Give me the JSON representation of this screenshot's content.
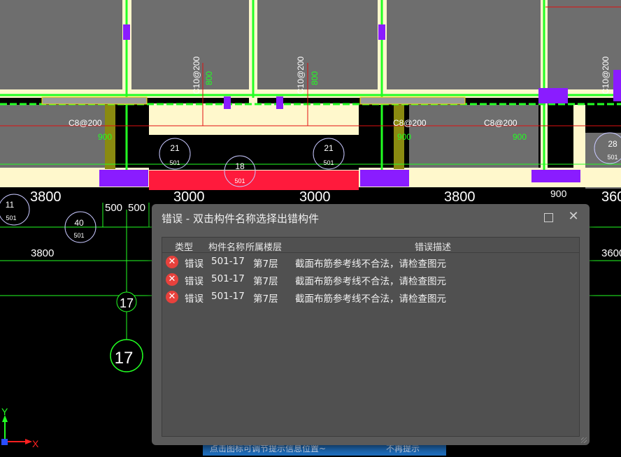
{
  "dialog": {
    "title": "错误 - 双击构件名称选择出错构件",
    "columns": [
      "类型",
      "构件名称",
      "所属楼层",
      "错误描述"
    ],
    "rows": [
      {
        "type": "错误",
        "name": "501-17",
        "floor": "第7层",
        "desc": "截面布筋参考线不合法，请检查图元"
      },
      {
        "type": "错误",
        "name": "501-17",
        "floor": "第7层",
        "desc": "截面布筋参考线不合法，请检查图元"
      },
      {
        "type": "错误",
        "name": "501-17",
        "floor": "第7层",
        "desc": "截面布筋参考线不合法，请检查图元"
      }
    ]
  },
  "toast": {
    "text1": "点击图标可调节提示信息位置~",
    "text2": "不再提示"
  },
  "drawing": {
    "dims_top": [
      "3800",
      "3000",
      "3000",
      "3800",
      "360"
    ],
    "dims_mid": [
      "500",
      "500",
      "900"
    ],
    "dims_low": [
      "3800",
      "3600"
    ],
    "beam_labels": [
      "C10@200",
      "C10@200",
      "C10@200",
      "C8@200",
      "C8@200",
      "C8@200"
    ],
    "green_labels": [
      "800",
      "800",
      "900",
      "900",
      "900"
    ],
    "circle_tags": [
      {
        "num": "11",
        "sub": "501"
      },
      {
        "num": "40",
        "sub": "501"
      },
      {
        "num": "21",
        "sub": "501"
      },
      {
        "num": "18",
        "sub": "501"
      },
      {
        "num": "21",
        "sub": "501"
      },
      {
        "num": "28",
        "sub": "501"
      }
    ],
    "axis_labels": [
      "17",
      "17"
    ],
    "ucs": {
      "x": "X",
      "y": "Y"
    }
  },
  "colors": {
    "dialog_bg": "#5a5a5a",
    "error_icon": "#e8413c",
    "concrete": "#6e6e6e",
    "slab": "#fff8cc",
    "red_member": "#ff1a3c",
    "cad_green": "#22ff22"
  }
}
